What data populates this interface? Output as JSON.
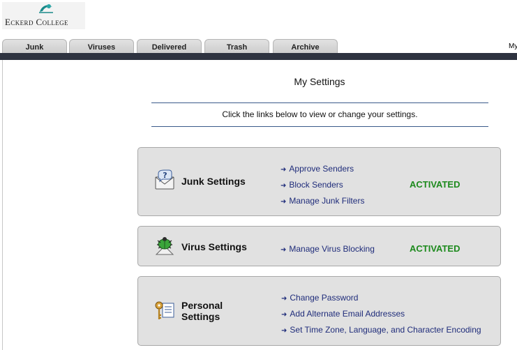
{
  "brand": {
    "college_name": "Eckerd College"
  },
  "tabs": [
    {
      "label": "Junk"
    },
    {
      "label": "Viruses"
    },
    {
      "label": "Delivered"
    },
    {
      "label": "Trash"
    },
    {
      "label": "Archive"
    }
  ],
  "top_right_link": "My",
  "page": {
    "title": "My Settings",
    "intro": "Click the links below to view or change your settings."
  },
  "panels": {
    "junk": {
      "title": "Junk Settings",
      "links": [
        "Approve Senders",
        "Block Senders",
        "Manage Junk Filters"
      ],
      "status": "ACTIVATED",
      "icon": "question-envelope-icon"
    },
    "virus": {
      "title": "Virus Settings",
      "links": [
        "Manage Virus Blocking"
      ],
      "status": "ACTIVATED",
      "icon": "bug-icon"
    },
    "personal": {
      "title_line1": "Personal",
      "title_line2": "Settings",
      "links": [
        "Change Password",
        "Add Alternate Email Addresses",
        "Set Time Zone, Language, and Character Encoding"
      ],
      "icon": "keys-document-icon"
    }
  },
  "colors": {
    "nav_bar": "#2e3340",
    "link": "#1f2c7a",
    "status_active": "#1d8a1d",
    "panel_bg": "#e1e1e1"
  }
}
